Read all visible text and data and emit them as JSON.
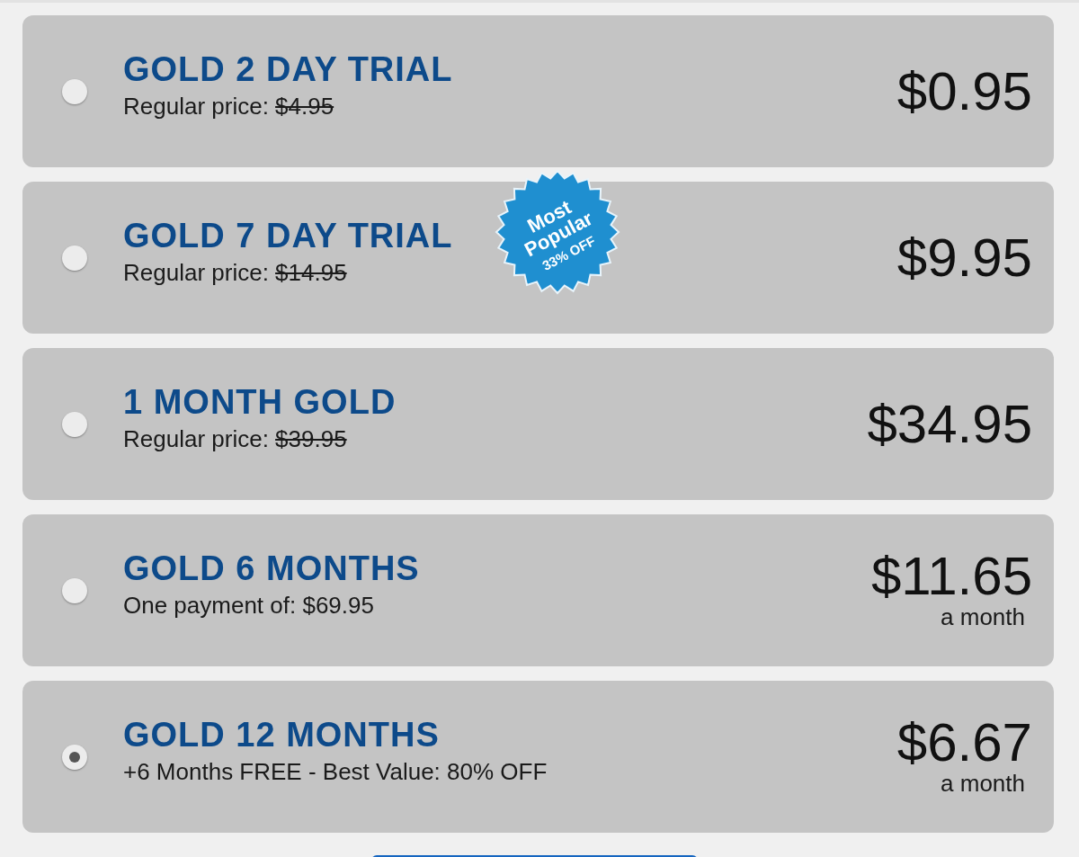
{
  "plans": [
    {
      "title": "GOLD 2 DAY TRIAL",
      "note": {
        "kind": "regular",
        "label": "Regular price:",
        "old_price": "$4.95"
      },
      "price": "$0.95",
      "selected": false
    },
    {
      "title": "GOLD 7 DAY TRIAL",
      "note": {
        "kind": "regular",
        "label": "Regular price:",
        "old_price": "$14.95"
      },
      "price": "$9.95",
      "selected": false,
      "badge": {
        "lines": [
          "Most",
          "Popular"
        ],
        "offer": "33% OFF"
      }
    },
    {
      "title": "1 MONTH GOLD",
      "note": {
        "kind": "regular",
        "label": "Regular price:",
        "old_price": "$39.95"
      },
      "price": "$34.95",
      "selected": false
    },
    {
      "title": "GOLD 6 MONTHS",
      "note": {
        "kind": "plain",
        "text": "One payment of: $69.95"
      },
      "price": "$11.65",
      "period": "a month",
      "selected": false
    },
    {
      "title": "GOLD 12 MONTHS",
      "note": {
        "kind": "plain",
        "text": "+6 Months FREE - Best Value: 80% OFF"
      },
      "price": "$6.67",
      "period": "a month",
      "selected": true
    }
  ]
}
